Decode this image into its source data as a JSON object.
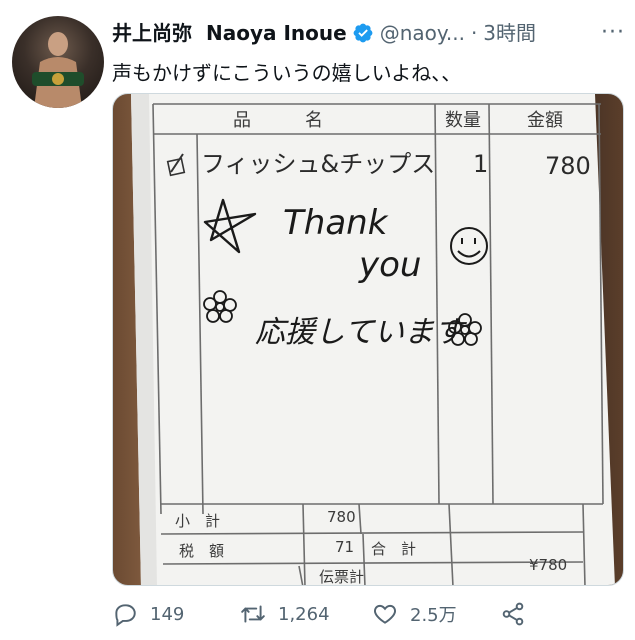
{
  "tweet": {
    "display_name": "井上尚弥",
    "username": "Naoya Inoue",
    "handle": "@naoy...",
    "separator": "·",
    "time": "3時間",
    "more": "···",
    "text": "声もかけずにこういうの嬉しいよね、、"
  },
  "receipt": {
    "header_item": "品　　　名",
    "header_qty": "数量",
    "header_price": "金額",
    "item_name": "フィッシュ&チップス",
    "item_qty": "1",
    "item_price": "780",
    "note_line1": "Thank",
    "note_line2": "you",
    "note_line3": "応援しています",
    "subtotal_label": "小　計",
    "subtotal_value": "780",
    "tax_label": "税　額",
    "tax_value": "71",
    "total_label": "合　計",
    "total_value": "¥780",
    "slip_label": "伝票計"
  },
  "actions": {
    "reply_count": "149",
    "retweet_count": "1,264",
    "like_count": "2.5万"
  },
  "colors": {
    "verified": "#1d9bf0",
    "muted": "#536471",
    "ink": "#1a1a1a"
  }
}
